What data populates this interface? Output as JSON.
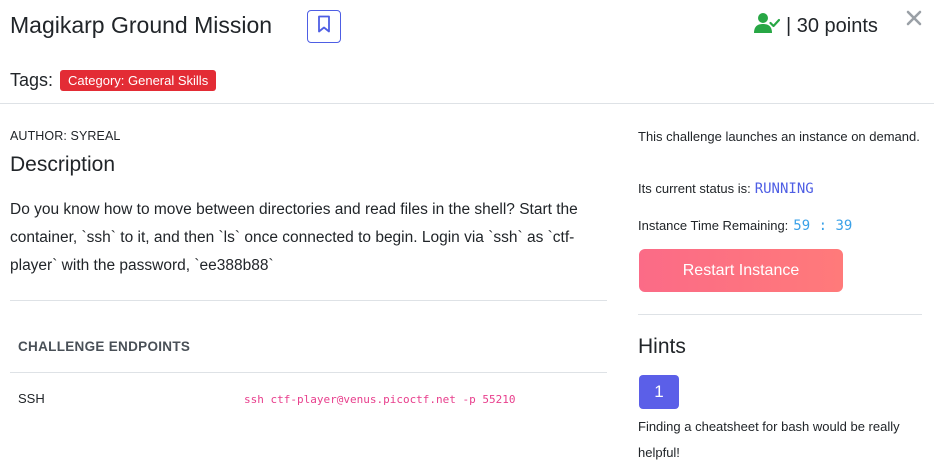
{
  "header": {
    "title": "Magikarp Ground Mission",
    "points_text": "| 30 points",
    "tags_label": "Tags:",
    "tag": "Category: General Skills",
    "icons": {
      "bookmark": "bookmark-icon",
      "solved": "user-check-icon",
      "close": "close-icon"
    },
    "colors": {
      "accent": "#4e5ee4",
      "solved_green": "#28a745",
      "tag_red": "#e32c35"
    }
  },
  "main": {
    "author": "AUTHOR: SYREAL",
    "description_heading": "Description",
    "description": "Do you know how to move between directories and read files in the shell? Start the container, `ssh` to it, and then `ls` once connected to begin. Login via `ssh` as `ctf-player` with the password, `ee388b88`",
    "endpoints_heading": "CHALLENGE ENDPOINTS",
    "endpoints": [
      {
        "name": "SSH",
        "value": "ssh ctf-player@venus.picoctf.net -p 55210"
      }
    ]
  },
  "sidebar": {
    "instance_info": "This challenge launches an instance on demand.",
    "status_label": "Its current status is:",
    "status_value": "RUNNING",
    "time_label": "Instance Time Remaining:",
    "time_value": "59 : 39",
    "restart_button": "Restart Instance",
    "hints_heading": "Hints",
    "hint_number": "1",
    "hint_text": "Finding a cheatsheet for bash would be really helpful!"
  }
}
